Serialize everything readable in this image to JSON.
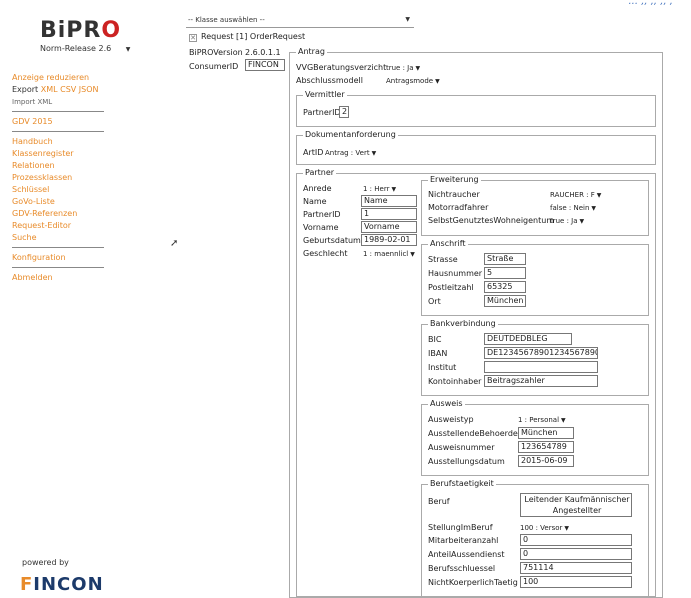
{
  "header": {
    "corner_text": "... ,, ,, ,, ,"
  },
  "sidebar": {
    "logo_prefix": "BiPR",
    "logo_mark": "O",
    "norm_label": "Norm-Release",
    "norm_value": "2.6",
    "group1": [
      "Anzeige reduzieren"
    ],
    "export_label": "Export",
    "export_formats": "XML CSV JSON",
    "import_label": "Import XML",
    "gdv": "GDV 2015",
    "group2": [
      "Handbuch",
      "Klassenregister",
      "Relationen",
      "Prozessklassen",
      "Schlüssel",
      "GoVo-Liste",
      "GDV-Referenzen",
      "Request-Editor",
      "Suche"
    ],
    "konfiguration": "Konfiguration",
    "abmelden": "Abmelden",
    "powered_by": "powered by",
    "vendor_f": "F",
    "vendor_rest": "INCON"
  },
  "form": {
    "klasse_placeholder": "-- Klasse auswählen --",
    "request_label": "Request [1] OrderRequest",
    "version_label": "BiPROVersion",
    "version_value": "2.6.0.1.1",
    "consumer_label": "ConsumerID",
    "consumer_value": "FINCON",
    "antrag": {
      "legend": "Antrag",
      "vvg_label": "VVGBeratungsverzicht",
      "vvg_value": "true : Ja",
      "abschluss_label": "Abschlussmodell",
      "abschluss_value": "Antragsmode",
      "vermittler": {
        "legend": "Vermittler",
        "partner_label": "PartnerID",
        "partner_value": "2"
      },
      "dokument": {
        "legend": "Dokumentanforderung",
        "artid_label": "ArtID",
        "artid_value": "Antrag : Vert"
      },
      "partner": {
        "legend": "Partner",
        "anrede_label": "Anrede",
        "anrede_value": "1 : Herr",
        "name_label": "Name",
        "name_value": "Name",
        "partnerid_label": "PartnerID",
        "partnerid_value": "1",
        "vorname_label": "Vorname",
        "vorname_value": "Vorname",
        "geburt_label": "Geburtsdatum",
        "geburt_value": "1989-02-01",
        "geschlecht_label": "Geschlecht",
        "geschlecht_value": "1 : maennlicl",
        "erweiterung": {
          "legend": "Erweiterung",
          "nichtraucher_label": "Nichtraucher",
          "nichtraucher_value": "RAUCHER : F",
          "motorrad_label": "Motorradfahrer",
          "motorrad_value": "false : Nein",
          "selbst_label": "SelbstGenutztesWohneigentum",
          "selbst_value": "true : Ja"
        },
        "anschrift": {
          "legend": "Anschrift",
          "strasse_label": "Strasse",
          "strasse_value": "Straße",
          "haus_label": "Hausnummer",
          "haus_value": "5",
          "plz_label": "Postleitzahl",
          "plz_value": "65325",
          "ort_label": "Ort",
          "ort_value": "München"
        },
        "bank": {
          "legend": "Bankverbindung",
          "bic_label": "BIC",
          "bic_value": "DEUTDEDBLEG",
          "iban_label": "IBAN",
          "iban_value": "DE12345678901234567890",
          "institut_label": "Institut",
          "institut_value": "",
          "inhaber_label": "Kontoinhaber",
          "inhaber_value": "Beitragszahler"
        },
        "ausweis": {
          "legend": "Ausweis",
          "typ_label": "Ausweistyp",
          "typ_value": "1 : Personal",
          "behoerde_label": "AusstellendeBehoerde",
          "behoerde_value": "München",
          "nummer_label": "Ausweisnummer",
          "nummer_value": "123654789",
          "datum_label": "Ausstellungsdatum",
          "datum_value": "2015-06-09"
        },
        "beruf": {
          "legend": "Berufstaetigkeit",
          "beruf_label": "Beruf",
          "beruf_value": "Leitender Kaufmännischer Angestellter",
          "stellung_label": "StellungImBeruf",
          "stellung_value": "100 : Versor",
          "mitarbeiter_label": "Mitarbeiteranzahl",
          "mitarbeiter_value": "0",
          "aussendienst_label": "AnteilAussendienst",
          "aussendienst_value": "0",
          "schluessel_label": "Berufsschluessel",
          "schluessel_value": "751114",
          "koerper_label": "NichtKoerperlichTaetig",
          "koerper_value": "100"
        }
      }
    }
  }
}
